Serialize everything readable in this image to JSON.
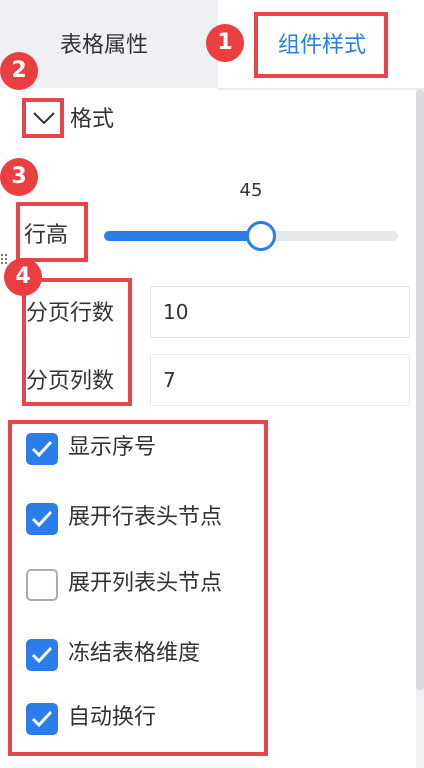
{
  "tabs": {
    "table_properties": "表格属性",
    "component_style": "组件样式"
  },
  "format_section": {
    "title": "格式",
    "expanded": true
  },
  "row_height": {
    "label": "行高",
    "value": "45",
    "fraction": 0.5
  },
  "pagination": {
    "rows_label": "分页行数",
    "rows_value": "10",
    "cols_label": "分页列数",
    "cols_value": "7"
  },
  "options": [
    {
      "label": "显示序号",
      "checked": true
    },
    {
      "label": "展开行表头节点",
      "checked": true
    },
    {
      "label": "展开列表头节点",
      "checked": false
    },
    {
      "label": "冻结表格维度",
      "checked": true
    },
    {
      "label": "自动换行",
      "checked": true
    }
  ],
  "annotations": [
    "1",
    "2",
    "3",
    "4"
  ],
  "colors": {
    "accent": "#2b7de9",
    "annotation_red": "#ea3e41"
  }
}
